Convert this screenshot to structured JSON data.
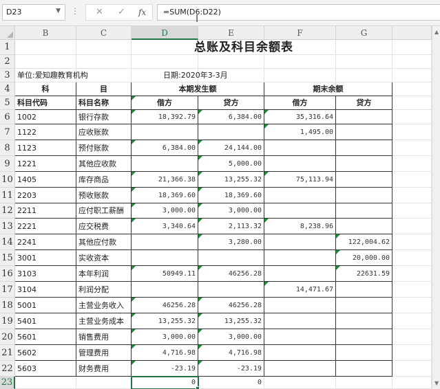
{
  "formula_bar": {
    "name_box": "D23",
    "formula": "=SUM(D6:D22)",
    "cancel_glyph": "✕",
    "enter_glyph": "✓",
    "fx_glyph": "fx"
  },
  "columns": [
    {
      "letter": "B",
      "active": false
    },
    {
      "letter": "C",
      "active": false
    },
    {
      "letter": "D",
      "active": true
    },
    {
      "letter": "E",
      "active": false
    },
    {
      "letter": "F",
      "active": false
    },
    {
      "letter": "G",
      "active": false
    }
  ],
  "sheet": {
    "title": "总账及科目余额表",
    "unit": "单位:爱知趣教育机构",
    "date": "日期:2020年3-3月",
    "hdr_ke": "科",
    "hdr_mu": "目",
    "hdr_period": "本期发生额",
    "hdr_balance": "期末余额",
    "hdr_code": "科目代码",
    "hdr_name": "科目名称",
    "hdr_debit": "借方",
    "hdr_credit": "贷方",
    "hdr_bal_debit": "借方",
    "hdr_bal_credit": "贷方",
    "rows": [
      {
        "n": "6",
        "code": "1002",
        "name": "银行存款",
        "d": "18,392.79",
        "e": "6,384.00",
        "f": "35,316.64",
        "g": ""
      },
      {
        "n": "7",
        "code": "1122",
        "name": "应收账款",
        "d": "",
        "e": "",
        "f": "1,495.00",
        "g": ""
      },
      {
        "n": "8",
        "code": "1123",
        "name": "预付账款",
        "d": "6,384.00",
        "e": "24,144.00",
        "f": "",
        "g": ""
      },
      {
        "n": "9",
        "code": "1221",
        "name": "其他应收款",
        "d": "",
        "e": "5,000.00",
        "f": "",
        "g": ""
      },
      {
        "n": "10",
        "code": "1405",
        "name": "库存商品",
        "d": "21,366.38",
        "e": "13,255.32",
        "f": "75,113.94",
        "g": ""
      },
      {
        "n": "11",
        "code": "2203",
        "name": "预收账款",
        "d": "18,369.60",
        "e": "18,369.60",
        "f": "",
        "g": ""
      },
      {
        "n": "12",
        "code": "2211",
        "name": "应付职工薪酬",
        "d": "3,000.00",
        "e": "3,000.00",
        "f": "",
        "g": ""
      },
      {
        "n": "13",
        "code": "2221",
        "name": "应交税费",
        "d": "3,340.64",
        "e": "2,113.32",
        "f": "8,238.96",
        "g": ""
      },
      {
        "n": "14",
        "code": "2241",
        "name": "其他应付款",
        "d": "",
        "e": "3,280.00",
        "f": "",
        "g": "122,004.62"
      },
      {
        "n": "15",
        "code": "3001",
        "name": "实收资本",
        "d": "",
        "e": "",
        "f": "",
        "g": "20,000.00"
      },
      {
        "n": "16",
        "code": "3103",
        "name": "本年利润",
        "d": "50949.11",
        "e": "46256.28",
        "f": "",
        "g": "22631.59"
      },
      {
        "n": "17",
        "code": "3104",
        "name": "利润分配",
        "d": "",
        "e": "",
        "f": "14,471.67",
        "g": ""
      },
      {
        "n": "18",
        "code": "5001",
        "name": "主营业务收入",
        "d": "46256.28",
        "e": "46256.28",
        "f": "",
        "g": ""
      },
      {
        "n": "19",
        "code": "5401",
        "name": "主营业务成本",
        "d": "13,255.32",
        "e": "13,255.32",
        "f": "",
        "g": ""
      },
      {
        "n": "20",
        "code": "5601",
        "name": "销售费用",
        "d": "3,000.00",
        "e": "3,000.00",
        "f": "",
        "g": ""
      },
      {
        "n": "21",
        "code": "5602",
        "name": "管理费用",
        "d": "4,716.98",
        "e": "4,716.98",
        "f": "",
        "g": ""
      },
      {
        "n": "22",
        "code": "5603",
        "name": "财务费用",
        "d": "-23.19",
        "e": "-23.19",
        "f": "",
        "g": ""
      }
    ],
    "total_d": "0",
    "total_e": "0"
  },
  "colors": {
    "accent": "#217346",
    "indicator": "#1e8c3a"
  }
}
